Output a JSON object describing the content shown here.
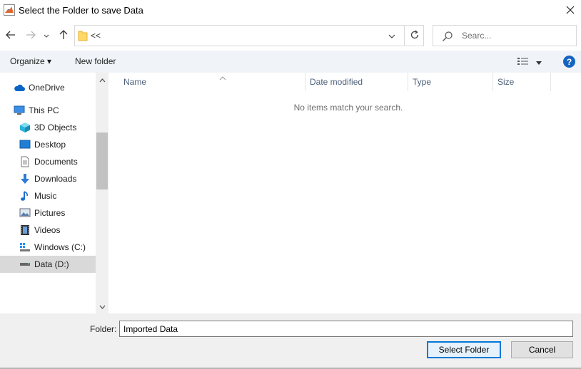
{
  "window": {
    "title": "Select the Folder to save Data",
    "icon": "matlab-icon"
  },
  "navigation": {
    "back_icon": "arrow-left-icon",
    "forward_icon": "arrow-right-icon",
    "recent_icon": "chevron-down-icon",
    "up_icon": "arrow-up-icon"
  },
  "address": {
    "text": "<<",
    "refresh_icon": "refresh-icon"
  },
  "search": {
    "placeholder": "Searc..."
  },
  "toolbar": {
    "organize_label": "Organize ▾",
    "new_folder_label": "New folder",
    "help_label": "?"
  },
  "nav_pane": {
    "items": [
      {
        "label": "OneDrive",
        "icon": "cloud-icon"
      },
      {
        "label": "This PC",
        "icon": "computer-icon"
      },
      {
        "label": "3D Objects",
        "icon": "cube-icon"
      },
      {
        "label": "Desktop",
        "icon": "desktop-icon"
      },
      {
        "label": "Documents",
        "icon": "document-icon"
      },
      {
        "label": "Downloads",
        "icon": "download-icon"
      },
      {
        "label": "Music",
        "icon": "music-icon"
      },
      {
        "label": "Pictures",
        "icon": "pictures-icon"
      },
      {
        "label": "Videos",
        "icon": "video-icon"
      },
      {
        "label": "Windows (C:)",
        "icon": "windows-drive-icon"
      },
      {
        "label": "Data (D:)",
        "icon": "drive-icon",
        "selected": true
      }
    ]
  },
  "file_list": {
    "columns": [
      "Name",
      "Date modified",
      "Type",
      "Size"
    ],
    "empty_message": "No items match your search."
  },
  "footer": {
    "folder_label": "Folder:",
    "folder_value": "Imported Data",
    "select_button": "Select Folder",
    "cancel_button": "Cancel"
  },
  "colors": {
    "accent": "#0078d7",
    "help": "#1565c0",
    "toolbar_bg": "#f0f4f8",
    "selected_bg": "#d9d9d9"
  }
}
